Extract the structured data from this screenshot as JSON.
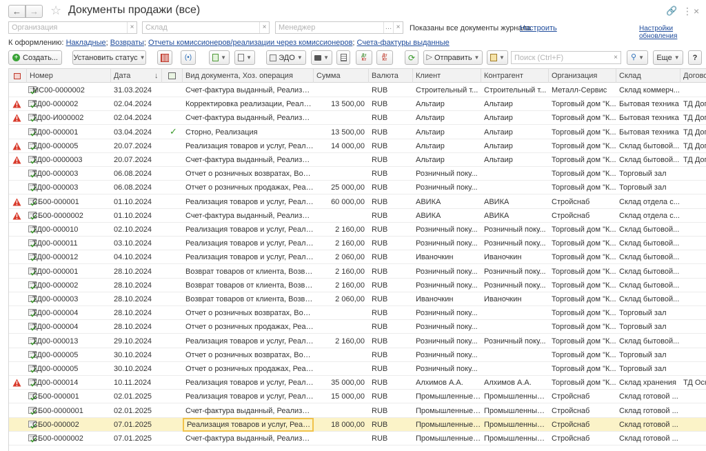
{
  "window": {
    "title": "Документы продажи (все)"
  },
  "filters": {
    "organization_placeholder": "Организация",
    "warehouse_placeholder": "Склад",
    "manager_placeholder": "Менеджер",
    "info_text": "Показаны все документы журнала",
    "configure_link": "Настроить",
    "update_settings_link": "Настройки обновления"
  },
  "draft": {
    "label": "К оформлению:",
    "links": [
      "Накладные",
      "Возвраты",
      "Отчеты комиссионеров/реализации через комиссионеров",
      "Счета-фактуры выданные"
    ]
  },
  "toolbar": {
    "create_label": "Создать...",
    "set_status_label": "Установить статус",
    "edo_label": "ЭДО",
    "send_label": "Отправить",
    "search_placeholder": "Поиск (Ctrl+F)",
    "more_label": "Еще",
    "dt_kt_top": "Дт",
    "dt_kt_bottom": "Кт"
  },
  "columns": [
    "Номер",
    "Дата",
    "Вид документа, Хоз. операция",
    "Сумма",
    "Валюта",
    "Клиент",
    "Контрагент",
    "Организация",
    "Склад",
    "Догово"
  ],
  "rows": [
    {
      "warn": false,
      "number": "МС00-0000002",
      "date": "31.03.2024",
      "posted": false,
      "doc": "Счет-фактура выданный, Реализация",
      "sum": "",
      "cur": "RUB",
      "client": "Строительный т...",
      "contr": "Строительный т...",
      "org": "Металл-Сервис",
      "wh": "Склад коммерч...",
      "contract": ""
    },
    {
      "warn": true,
      "number": "ТД00-000002",
      "date": "02.04.2024",
      "posted": false,
      "doc": "Корректировка реализации, Реализация",
      "sum": "13 500,00",
      "cur": "RUB",
      "client": "Альтаир",
      "contr": "Альтаир",
      "org": "Торговый дом \"К...",
      "wh": "Бытовая техника",
      "contract": "ТД Дог"
    },
    {
      "warn": true,
      "number": "ТД00-И000002",
      "date": "02.04.2024",
      "posted": false,
      "doc": "Счет-фактура выданный, Реализация",
      "sum": "",
      "cur": "RUB",
      "client": "Альтаир",
      "contr": "Альтаир",
      "org": "Торговый дом \"К...",
      "wh": "Бытовая техника",
      "contract": "ТД Дог"
    },
    {
      "warn": false,
      "number": "ТД00-000001",
      "date": "03.04.2024",
      "posted": true,
      "doc": "Сторно, Реализация",
      "sum": "13 500,00",
      "cur": "RUB",
      "client": "Альтаир",
      "contr": "Альтаир",
      "org": "Торговый дом \"К...",
      "wh": "Бытовая техника",
      "contract": "ТД Дог"
    },
    {
      "warn": true,
      "number": "ТД00-000005",
      "date": "20.07.2024",
      "posted": false,
      "doc": "Реализация товаров и услуг, Реализа...",
      "sum": "14 000,00",
      "cur": "RUB",
      "client": "Альтаир",
      "contr": "Альтаир",
      "org": "Торговый дом \"К...",
      "wh": "Склад бытовой...",
      "contract": "ТД Дог"
    },
    {
      "warn": true,
      "number": "ТД00-0000003",
      "date": "20.07.2024",
      "posted": false,
      "doc": "Счет-фактура выданный, Реализация",
      "sum": "",
      "cur": "RUB",
      "client": "Альтаир",
      "contr": "Альтаир",
      "org": "Торговый дом \"К...",
      "wh": "Склад бытовой...",
      "contract": "ТД Дог"
    },
    {
      "warn": false,
      "number": "ТД00-000003",
      "date": "06.08.2024",
      "posted": false,
      "doc": "Отчет о розничных возвратах, Возвр...",
      "sum": "",
      "cur": "RUB",
      "client": "Розничный поку...",
      "contr": "",
      "org": "Торговый дом \"К...",
      "wh": "Торговый зал",
      "contract": ""
    },
    {
      "warn": false,
      "number": "ТД00-000003",
      "date": "06.08.2024",
      "posted": false,
      "doc": "Отчет о розничных продажах, Реализ...",
      "sum": "25 000,00",
      "cur": "RUB",
      "client": "Розничный поку...",
      "contr": "",
      "org": "Торговый дом \"К...",
      "wh": "Торговый зал",
      "contract": ""
    },
    {
      "warn": true,
      "number": "СБ00-000001",
      "date": "01.10.2024",
      "posted": false,
      "doc": "Реализация товаров и услуг, Реализа...",
      "sum": "60 000,00",
      "cur": "RUB",
      "client": "АВИКА",
      "contr": "АВИКА",
      "org": "Стройснаб",
      "wh": "Склад отдела с...",
      "contract": ""
    },
    {
      "warn": true,
      "number": "СБ00-0000002",
      "date": "01.10.2024",
      "posted": false,
      "doc": "Счет-фактура выданный, Реализация",
      "sum": "",
      "cur": "RUB",
      "client": "АВИКА",
      "contr": "АВИКА",
      "org": "Стройснаб",
      "wh": "Склад отдела с...",
      "contract": ""
    },
    {
      "warn": false,
      "number": "ТД00-000010",
      "date": "02.10.2024",
      "posted": false,
      "doc": "Реализация товаров и услуг, Реализа...",
      "sum": "2 160,00",
      "cur": "RUB",
      "client": "Розничный поку...",
      "contr": "Розничный поку...",
      "org": "Торговый дом \"К...",
      "wh": "Склад бытовой...",
      "contract": ""
    },
    {
      "warn": false,
      "number": "ТД00-000011",
      "date": "03.10.2024",
      "posted": false,
      "doc": "Реализация товаров и услуг, Реализа...",
      "sum": "2 160,00",
      "cur": "RUB",
      "client": "Розничный поку...",
      "contr": "Розничный поку...",
      "org": "Торговый дом \"К...",
      "wh": "Склад бытовой...",
      "contract": ""
    },
    {
      "warn": false,
      "number": "ТД00-000012",
      "date": "04.10.2024",
      "posted": false,
      "doc": "Реализация товаров и услуг, Реализа...",
      "sum": "2 060,00",
      "cur": "RUB",
      "client": "Иваночкин",
      "contr": "Иваночкин",
      "org": "Торговый дом \"К...",
      "wh": "Склад бытовой...",
      "contract": ""
    },
    {
      "warn": false,
      "number": "ТД00-000001",
      "date": "28.10.2024",
      "posted": false,
      "doc": "Возврат товаров от клиента, Возврат...",
      "sum": "2 160,00",
      "cur": "RUB",
      "client": "Розничный поку...",
      "contr": "Розничный поку...",
      "org": "Торговый дом \"К...",
      "wh": "Склад бытовой...",
      "contract": ""
    },
    {
      "warn": false,
      "number": "ТД00-000002",
      "date": "28.10.2024",
      "posted": false,
      "doc": "Возврат товаров от клиента, Возврат...",
      "sum": "2 160,00",
      "cur": "RUB",
      "client": "Розничный поку...",
      "contr": "Розничный поку...",
      "org": "Торговый дом \"К...",
      "wh": "Склад бытовой...",
      "contract": ""
    },
    {
      "warn": false,
      "number": "ТД00-000003",
      "date": "28.10.2024",
      "posted": false,
      "doc": "Возврат товаров от клиента, Возврат...",
      "sum": "2 060,00",
      "cur": "RUB",
      "client": "Иваночкин",
      "contr": "Иваночкин",
      "org": "Торговый дом \"К...",
      "wh": "Склад бытовой...",
      "contract": ""
    },
    {
      "warn": false,
      "number": "ТД00-000004",
      "date": "28.10.2024",
      "posted": false,
      "doc": "Отчет о розничных возвратах, Возвр...",
      "sum": "",
      "cur": "RUB",
      "client": "Розничный поку...",
      "contr": "",
      "org": "Торговый дом \"К...",
      "wh": "Торговый зал",
      "contract": ""
    },
    {
      "warn": false,
      "number": "ТД00-000004",
      "date": "28.10.2024",
      "posted": false,
      "doc": "Отчет о розничных продажах, Реализ...",
      "sum": "",
      "cur": "RUB",
      "client": "Розничный поку...",
      "contr": "",
      "org": "Торговый дом \"К...",
      "wh": "Торговый зал",
      "contract": ""
    },
    {
      "warn": false,
      "number": "ТД00-000013",
      "date": "29.10.2024",
      "posted": false,
      "doc": "Реализация товаров и услуг, Реализа...",
      "sum": "2 160,00",
      "cur": "RUB",
      "client": "Розничный поку...",
      "contr": "Розничный поку...",
      "org": "Торговый дом \"К...",
      "wh": "Склад бытовой...",
      "contract": ""
    },
    {
      "warn": false,
      "number": "ТД00-000005",
      "date": "30.10.2024",
      "posted": false,
      "doc": "Отчет о розничных возвратах, Возвр...",
      "sum": "",
      "cur": "RUB",
      "client": "Розничный поку...",
      "contr": "",
      "org": "Торговый дом \"К...",
      "wh": "Торговый зал",
      "contract": ""
    },
    {
      "warn": false,
      "number": "ТД00-000005",
      "date": "30.10.2024",
      "posted": false,
      "doc": "Отчет о розничных продажах, Реализ...",
      "sum": "",
      "cur": "RUB",
      "client": "Розничный поку...",
      "contr": "",
      "org": "Торговый дом \"К...",
      "wh": "Торговый зал",
      "contract": ""
    },
    {
      "warn": true,
      "number": "ТД00-000014",
      "date": "10.11.2024",
      "posted": false,
      "doc": "Реализация товаров и услуг, Реализа...",
      "sum": "35 000,00",
      "cur": "RUB",
      "client": "Алхимов А.А.",
      "contr": "Алхимов А.А.",
      "org": "Торговый дом \"К...",
      "wh": "Склад хранения",
      "contract": "ТД Осн"
    },
    {
      "warn": false,
      "number": "СБ00-000001",
      "date": "02.01.2025",
      "posted": false,
      "doc": "Реализация товаров и услуг, Реализа...",
      "sum": "15 000,00",
      "cur": "RUB",
      "client": "Промышленные ...",
      "contr": "Промышленные ...",
      "org": "Стройснаб",
      "wh": "Склад готовой ...",
      "contract": ""
    },
    {
      "warn": false,
      "number": "СБ00-0000001",
      "date": "02.01.2025",
      "posted": false,
      "doc": "Счет-фактура выданный, Реализация",
      "sum": "",
      "cur": "RUB",
      "client": "Промышленные ...",
      "contr": "Промышленные ...",
      "org": "Стройснаб",
      "wh": "Склад готовой ...",
      "contract": ""
    },
    {
      "warn": false,
      "number": "СБ00-000002",
      "date": "07.01.2025",
      "posted": false,
      "doc": "Реализация товаров и услуг, Реализа...",
      "sum": "18 000,00",
      "cur": "RUB",
      "client": "Промышленные ...",
      "contr": "Промышленные ...",
      "org": "Стройснаб",
      "wh": "Склад готовой ...",
      "contract": "",
      "selected": true
    },
    {
      "warn": false,
      "number": "СБ00-0000002",
      "date": "07.01.2025",
      "posted": false,
      "doc": "Счет-фактура выданный, Реализация",
      "sum": "",
      "cur": "RUB",
      "client": "Промышленные ...",
      "contr": "Промышленные ...",
      "org": "Стройснаб",
      "wh": "Склад готовой ...",
      "contract": ""
    }
  ],
  "colors": {
    "accent_link": "#1e4b9b",
    "selected_row": "#fbf3c8",
    "warning": "#d93a2b",
    "posted_check": "#3a9a2b"
  }
}
